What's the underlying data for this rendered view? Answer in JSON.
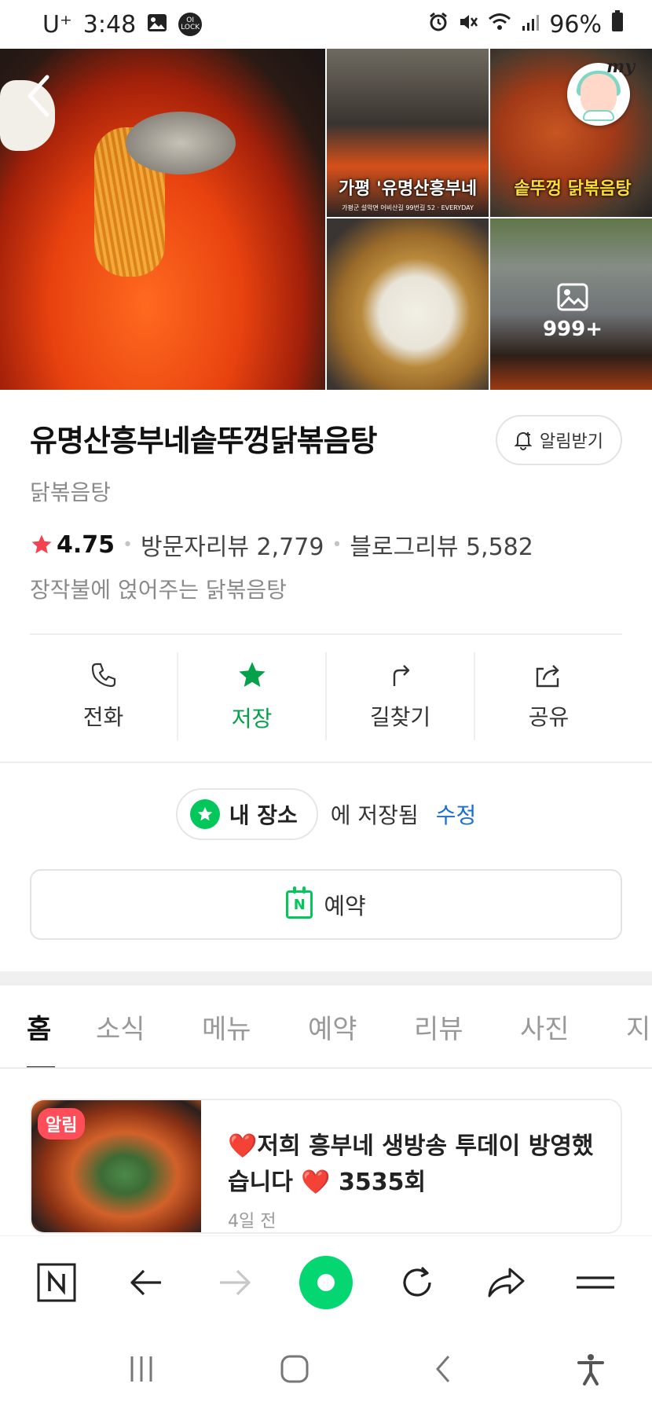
{
  "status_bar": {
    "carrier": "U⁺",
    "time": "3:48",
    "lock_label": "OI LOCK",
    "battery": "96%"
  },
  "gallery": {
    "photo2_caption": "가평 '유명산흥부네",
    "photo2_subcaption": "가평군 설악면 어비산길 99번길 52 · EVERYDAY",
    "photo3_caption": "솥뚜껑 닭볶음탕",
    "more_count": "999+",
    "avatar_tag": "my"
  },
  "place": {
    "name": "유명산흥부네솥뚜껑닭볶음탕",
    "category": "닭볶음탕",
    "alarm_label": "알림받기",
    "rating": "4.75",
    "visitor_reviews": "방문자리뷰 2,779",
    "blog_reviews": "블로그리뷰 5,582",
    "description": "장작불에 얹어주는 닭볶음탕"
  },
  "actions": [
    {
      "label": "전화"
    },
    {
      "label": "저장"
    },
    {
      "label": "길찾기"
    },
    {
      "label": "공유"
    }
  ],
  "saved": {
    "folder": "내 장소",
    "status": "에 저장됨",
    "edit": "수정"
  },
  "reserve": {
    "label": "예약",
    "icon_letter": "N"
  },
  "tabs": [
    "홈",
    "소식",
    "메뉴",
    "예약",
    "리뷰",
    "사진",
    "지"
  ],
  "news": {
    "badge": "알림",
    "title": "❤️저희 흥부네 생방송 투데이 방영했습니다 ❤️ 3535회",
    "time": "4일 전"
  },
  "colors": {
    "naver_green": "#03c75a",
    "saved_green": "#03a14a",
    "link_blue": "#1b6ed1",
    "rating_red": "#f4434f",
    "badge_red": "#ff4e5a"
  }
}
